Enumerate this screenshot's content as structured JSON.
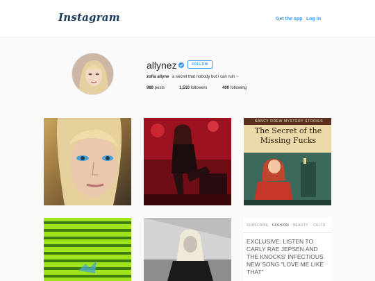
{
  "header": {
    "logo": "Instagram",
    "get_app": "Get the app",
    "login": "Log in"
  },
  "profile": {
    "username": "allynez",
    "verified": true,
    "follow_label": "FOLLOW",
    "full_name": "zofia allyne",
    "bio": "a secret that nobody but i can ruin ~",
    "posts_count": "989",
    "posts_label": "posts",
    "followers_count": "1,510",
    "followers_label": "followers",
    "following_count": "400",
    "following_label": "following"
  },
  "posts": [
    {
      "subject": "close-up portrait of blonde woman with blue eye makeup"
    },
    {
      "subject": "performer on stage under red lights"
    },
    {
      "subject": "book cover",
      "series": "NANCY DREW MYSTERY STORIES",
      "title": "The Secret of the Missing Fucks"
    },
    {
      "subject": "green striped window blinds"
    },
    {
      "subject": "black and white photo of woman with blonde hair"
    },
    {
      "subject": "magazine article",
      "nav": [
        "SUBSCRIBE",
        "FASHION",
        "BEAUTY",
        "CULTU"
      ],
      "headline": "EXCLUSIVE: LISTEN TO CARLY RAE JEPSEN AND THE KNOCKS' INFECTIOUS NEW SONG \"LOVE ME LIKE THAT\""
    }
  ],
  "colors": {
    "accent": "#3897f0",
    "background": "#fafafa",
    "logo": "#1b3b5a"
  }
}
